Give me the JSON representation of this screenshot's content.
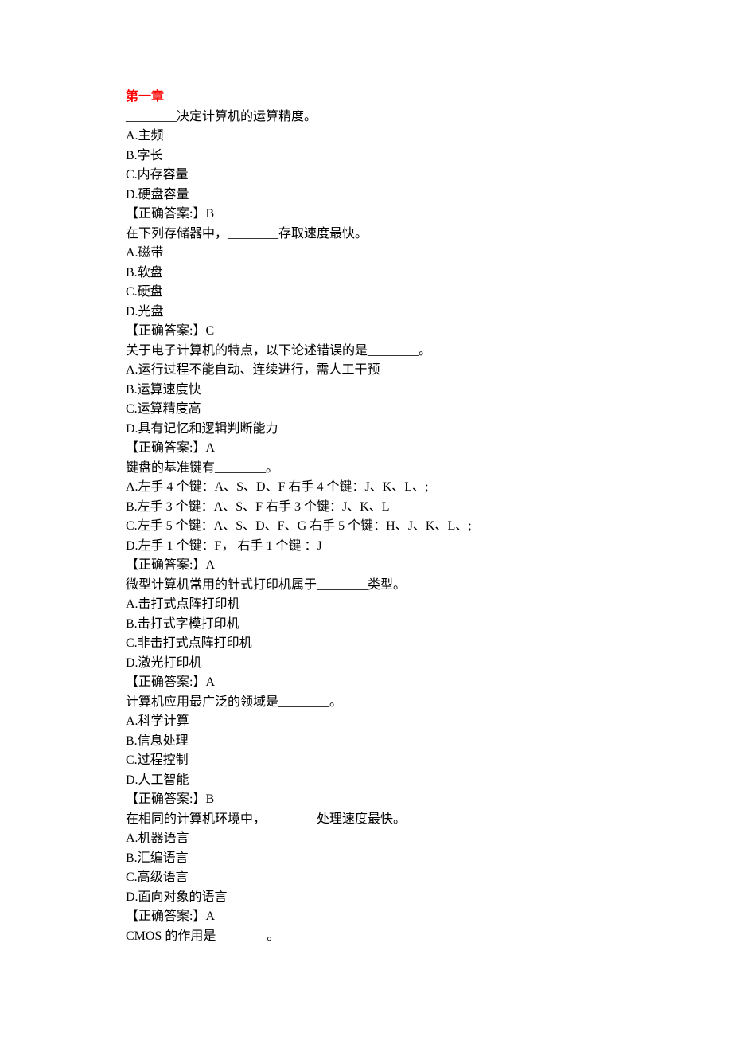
{
  "chapter_title": "第一章",
  "questions": [
    {
      "stem": "________决定计算机的运算精度。",
      "options": [
        "A.主频",
        "B.字长",
        "C.内存容量",
        "D.硬盘容量"
      ],
      "answer_label": "【正确答案:】",
      "answer": "B"
    },
    {
      "stem": "在下列存储器中，________存取速度最快。",
      "options": [
        "A.磁带",
        "B.软盘",
        "C.硬盘",
        "D.光盘"
      ],
      "answer_label": "【正确答案:】",
      "answer": "C"
    },
    {
      "stem": "关于电子计算机的特点，以下论述错误的是________。",
      "options": [
        "A.运行过程不能自动、连续进行，需人工干预",
        "B.运算速度快",
        "C.运算精度高",
        "D.具有记忆和逻辑判断能力"
      ],
      "answer_label": "【正确答案:】",
      "answer": "A"
    },
    {
      "stem": "键盘的基准键有________。",
      "options": [
        "A.左手 4 个键：A、S、D、F  右手 4 个键：J、K、L、;",
        "B.左手 3 个键：A、S、F  右手 3 个键：J、K、L",
        "C.左手 5 个键：A、S、D、F、G  右手 5 个键：H、J、K、L、;",
        "D.左手 1 个键：F，  右手 1 个键 ：J"
      ],
      "answer_label": "【正确答案:】",
      "answer": "A"
    },
    {
      "stem": "微型计算机常用的针式打印机属于________类型。",
      "options": [
        "A.击打式点阵打印机",
        "B.击打式字模打印机",
        "C.非击打式点阵打印机",
        "D.激光打印机"
      ],
      "answer_label": "【正确答案:】",
      "answer": "A"
    },
    {
      "stem": "计算机应用最广泛的领域是________。",
      "options": [
        "A.科学计算",
        "B.信息处理",
        "C.过程控制",
        "D.人工智能"
      ],
      "answer_label": "【正确答案:】",
      "answer": "B"
    },
    {
      "stem": "在相同的计算机环境中，________处理速度最快。",
      "options": [
        "A.机器语言",
        "B.汇编语言",
        "C.高级语言",
        "D.面向对象的语言"
      ],
      "answer_label": "【正确答案:】",
      "answer": "A"
    },
    {
      "stem": "CMOS 的作用是________。",
      "options": [],
      "answer_label": "",
      "answer": ""
    }
  ]
}
